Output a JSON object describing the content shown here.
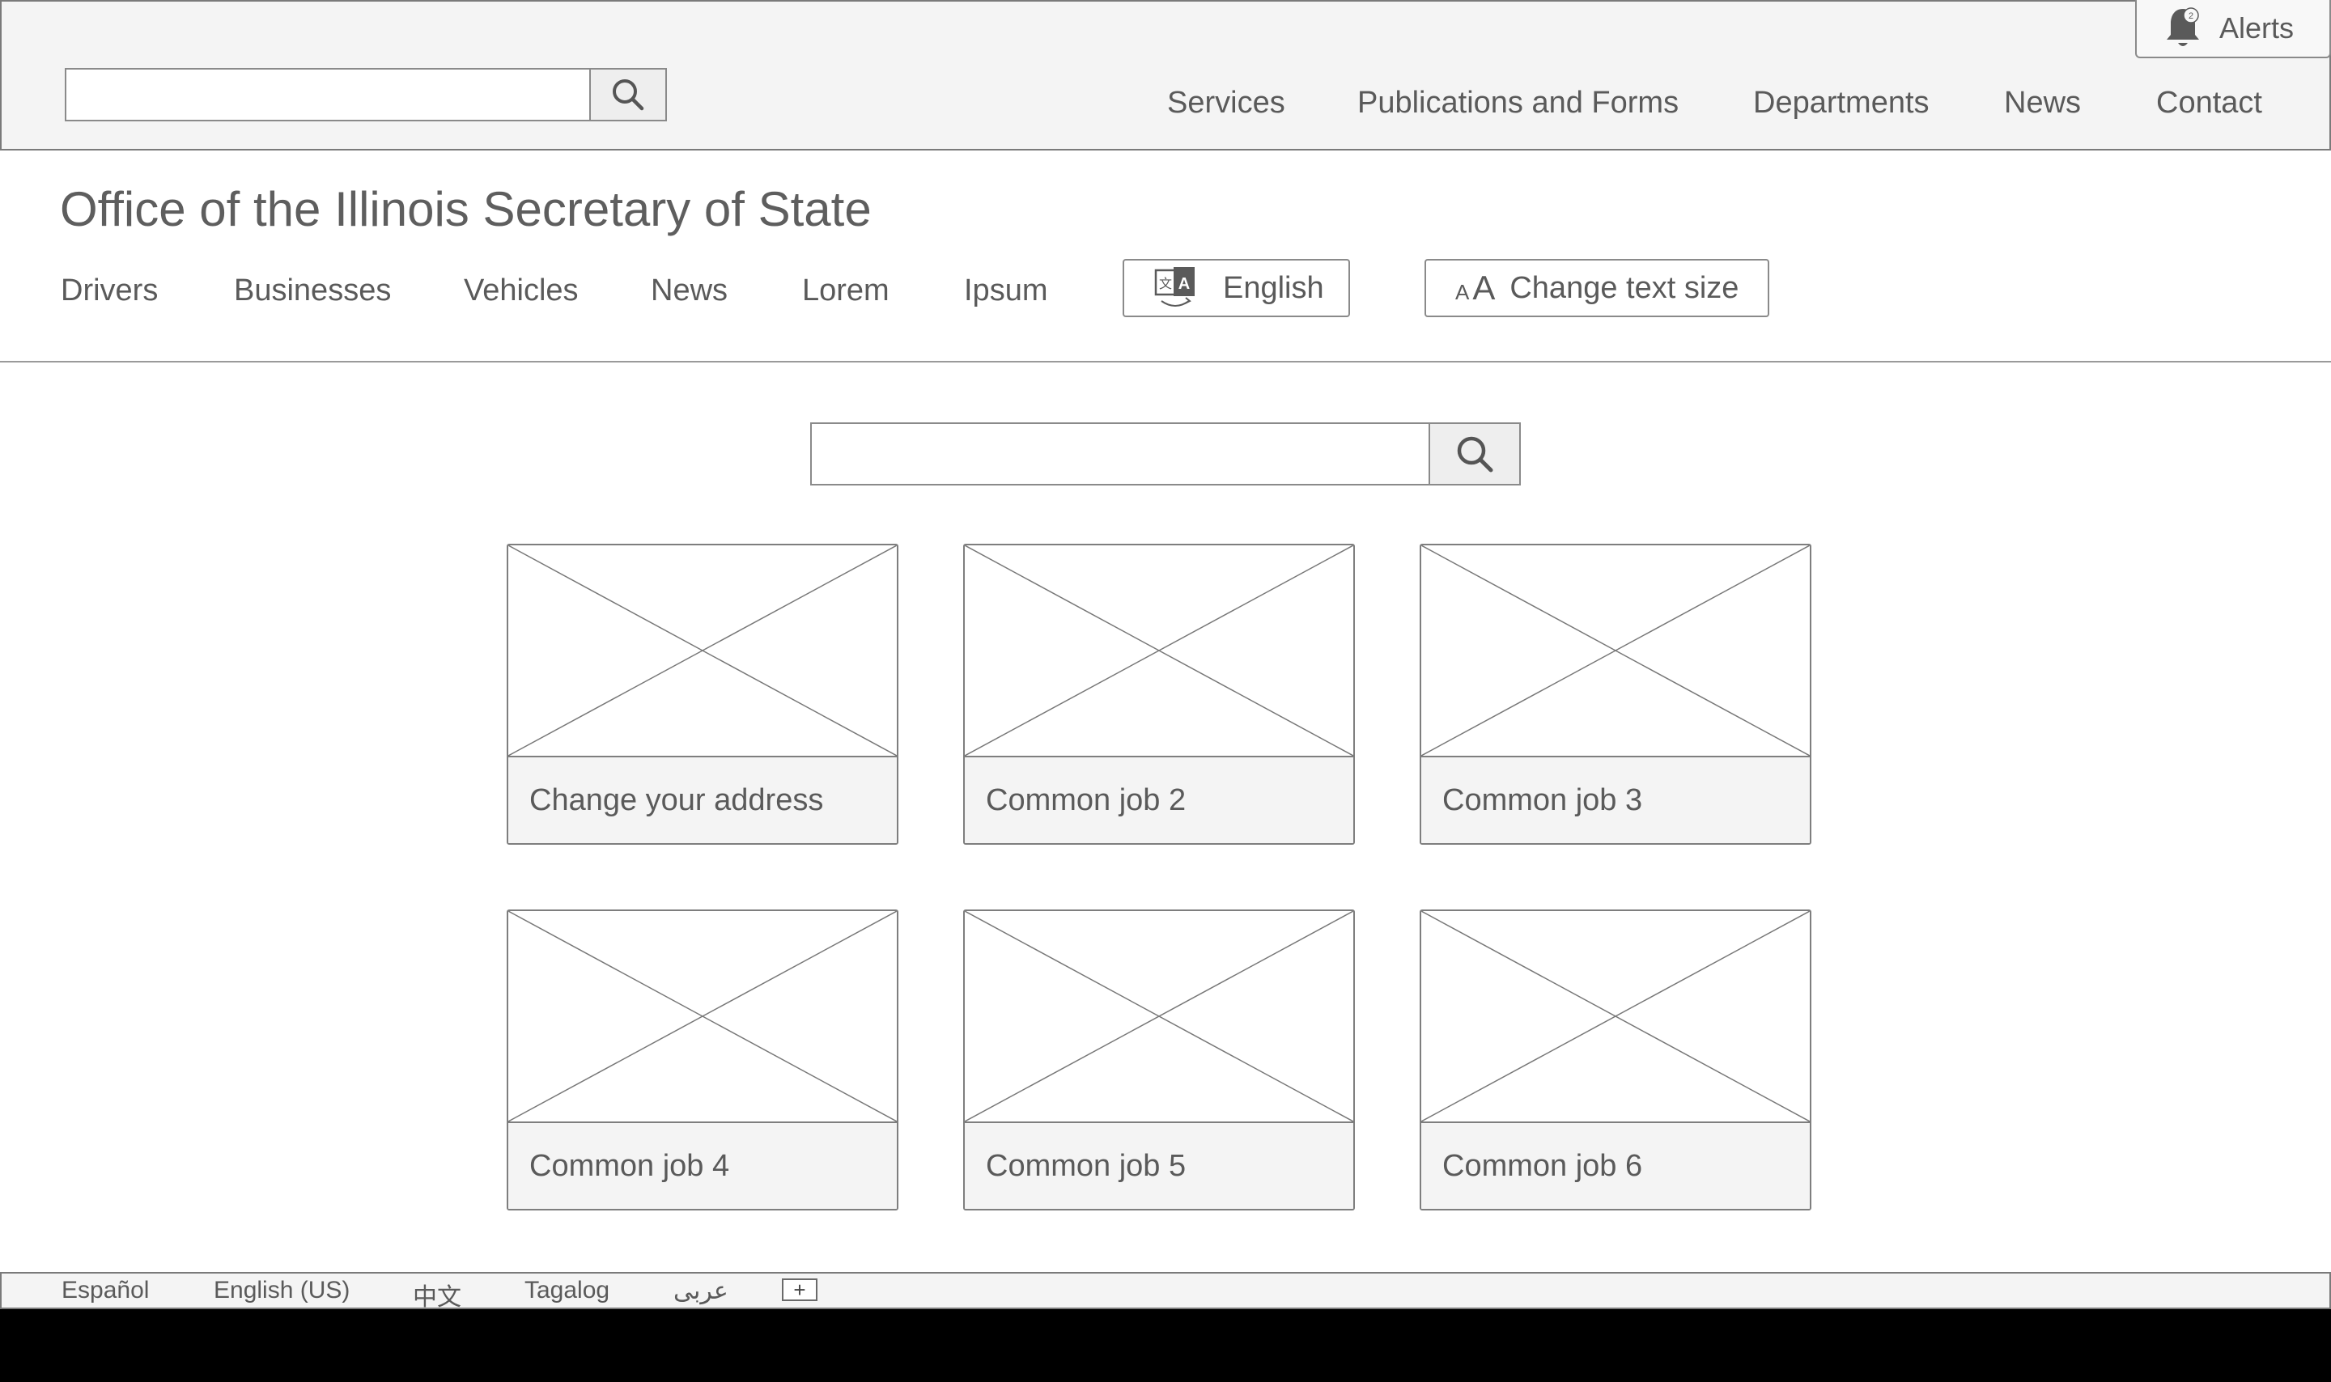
{
  "header": {
    "alerts": {
      "label": "Alerts",
      "badge": "2"
    },
    "nav": [
      "Services",
      "Publications and Forms",
      "Departments",
      "News",
      "Contact"
    ]
  },
  "site": {
    "title": "Office of the Illinois Secretary of State",
    "subnav": [
      "Drivers",
      "Businesses",
      "Vehicles",
      "News",
      "Lorem",
      "Ipsum"
    ],
    "language_button": "English",
    "text_size_button": "Change text size",
    "text_size_glyph_small": "A",
    "text_size_glyph_large": "A"
  },
  "cards": [
    {
      "label": "Change your address"
    },
    {
      "label": "Common job 2"
    },
    {
      "label": "Common job 3"
    },
    {
      "label": "Common job 4"
    },
    {
      "label": "Common job 5"
    },
    {
      "label": "Common job 6"
    }
  ],
  "footer": {
    "languages": [
      "Español",
      "English (US)",
      "中文",
      "Tagalog",
      "عربى"
    ],
    "more_symbol": "+"
  },
  "colors": {
    "chrome_bg": "#f4f4f4",
    "border": "#8a8a8a",
    "text": "#5a5a5a",
    "letterbox": "#000000"
  },
  "icons": [
    "search-icon",
    "bell-icon",
    "translate-icon",
    "text-size-icon",
    "plus-icon",
    "image-placeholder-icon"
  ]
}
